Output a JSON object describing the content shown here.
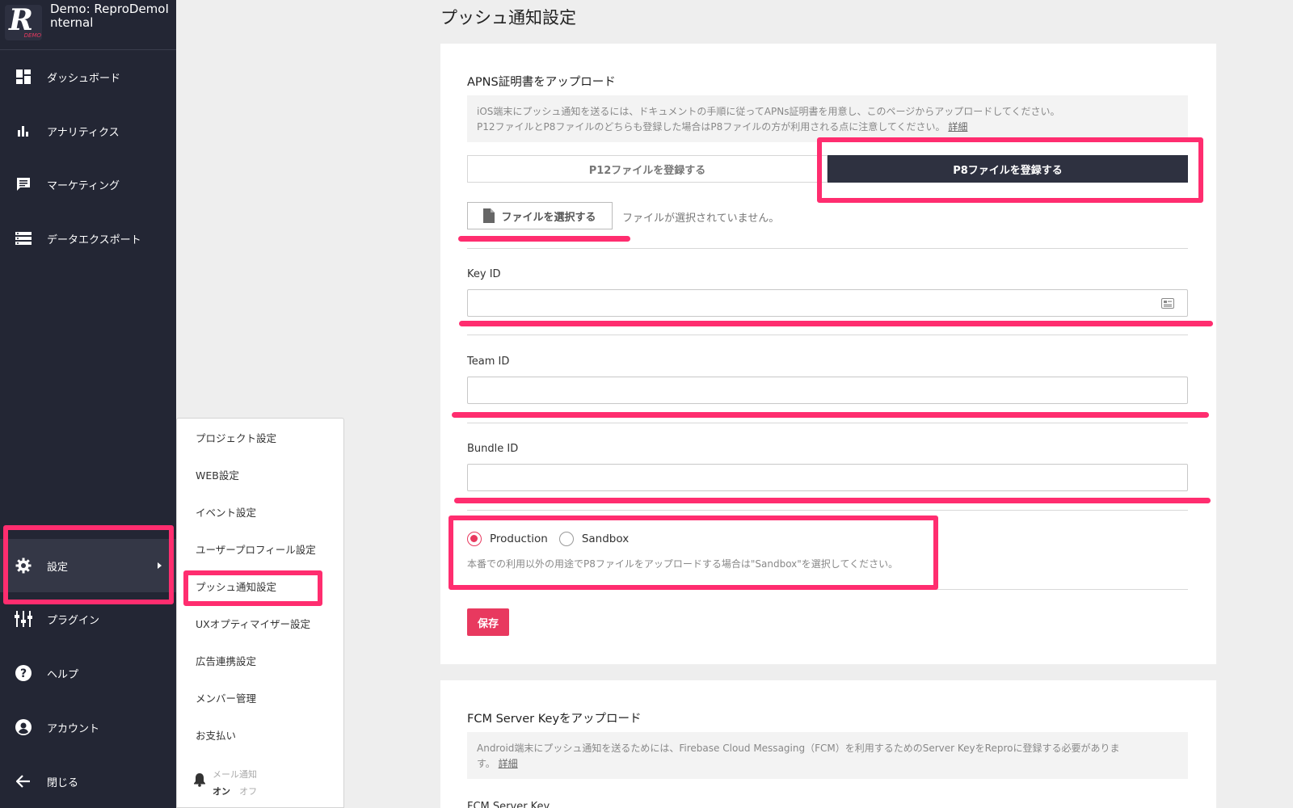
{
  "brand": {
    "logo_letter": "R",
    "logo_badge": "DEMO",
    "project_name": "Demo: ReproDemoInternal"
  },
  "sidebar": {
    "items": [
      {
        "label": "ダッシュボード",
        "icon": "dashboard-icon"
      },
      {
        "label": "アナリティクス",
        "icon": "bar-chart-icon"
      },
      {
        "label": "マーケティング",
        "icon": "chat-icon"
      },
      {
        "label": "データエクスポート",
        "icon": "list-icon"
      },
      {
        "label": "設定",
        "icon": "gear-icon"
      },
      {
        "label": "プラグイン",
        "icon": "plugin-icon"
      },
      {
        "label": "ヘルプ",
        "icon": "help-icon"
      },
      {
        "label": "アカウント",
        "icon": "account-icon"
      },
      {
        "label": "閉じる",
        "icon": "arrow-left-icon"
      }
    ]
  },
  "settings_menu": {
    "items": [
      {
        "label": "プロジェクト設定"
      },
      {
        "label": "WEB設定"
      },
      {
        "label": "イベント設定"
      },
      {
        "label": "ユーザープロフィール設定"
      },
      {
        "label": "プッシュ通知設定"
      },
      {
        "label": "UXオプティマイザー設定"
      },
      {
        "label": "広告連携設定"
      },
      {
        "label": "メンバー管理"
      },
      {
        "label": "お支払い"
      }
    ],
    "mail_notification": {
      "label": "メール通知",
      "on": "オン",
      "off": "オフ"
    }
  },
  "page": {
    "title": "プッシュ通知設定"
  },
  "apns": {
    "title": "APNS証明書をアップロード",
    "info_line1": "iOS端末にプッシュ通知を送るには、ドキュメントの手順に従ってAPNs証明書を用意し、このページからアップロードしてください。",
    "info_line2": "P12ファイルとP8ファイルのどちらも登録した場合はP8ファイルの方が利用される点に注意してください。",
    "info_link": "詳細",
    "p12_button": "P12ファイルを登録する",
    "p8_button": "P8ファイルを登録する",
    "choose_file_button": "ファイルを選択する",
    "no_file_text": "ファイルが選択されていません。",
    "key_id_label": "Key ID",
    "team_id_label": "Team ID",
    "bundle_id_label": "Bundle ID",
    "radio_production": "Production",
    "radio_sandbox": "Sandbox",
    "selected_environment": "Production",
    "radio_note": "本番での利用以外の用途でP8ファイルをアップロードする場合は\"Sandbox\"を選択してください。",
    "save_button": "保存"
  },
  "fcm": {
    "title": "FCM Server Keyをアップロード",
    "info_line1": "Android端末にプッシュ通知を送るためには、Firebase Cloud Messaging（FCM）を利用するためのServer KeyをReproに登録する必要がありま",
    "info_line2": "す。",
    "info_link": "詳細",
    "server_key_label": "FCM Server Key"
  },
  "colors": {
    "accent": "#e8395f",
    "highlight": "#ff2d6f",
    "sidebar": "#232634"
  }
}
